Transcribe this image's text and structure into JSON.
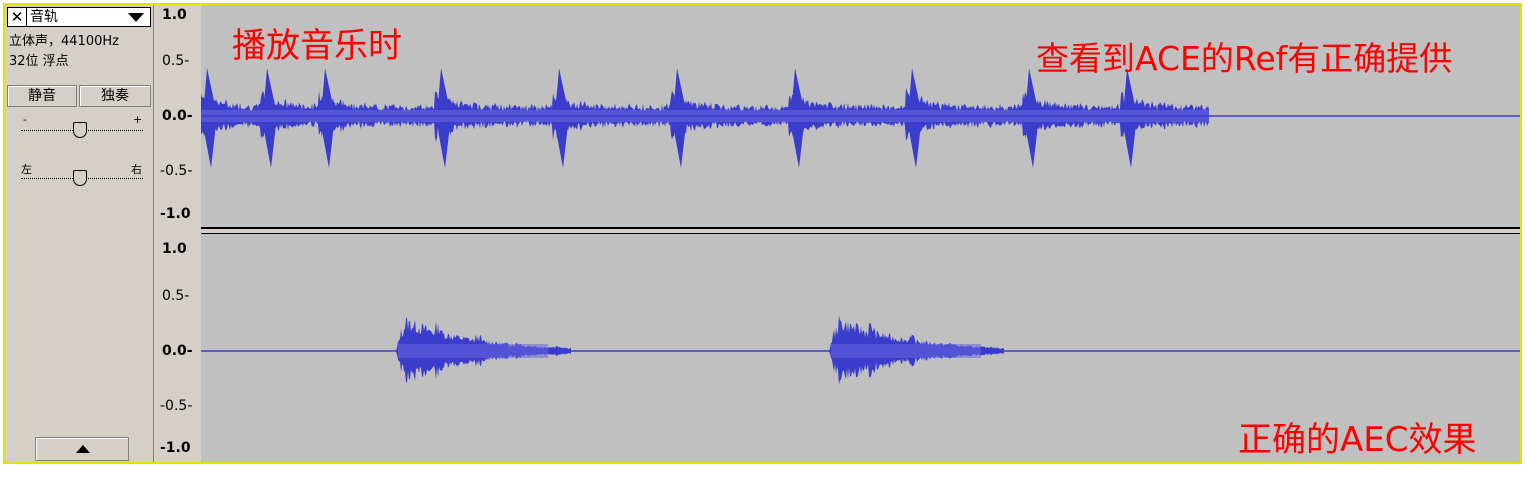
{
  "track": {
    "close_glyph": "✕",
    "name": "音轨",
    "channels_rate": "立体声，44100Hz",
    "format": "32位 浮点",
    "mute_label": "静音",
    "solo_label": "独奏",
    "gain_minus": "-",
    "gain_plus": "+",
    "pan_left": "左",
    "pan_right": "右"
  },
  "scale": {
    "top": [
      "1.0",
      "0.5-",
      "0.0-",
      "-0.5-",
      "-1.0"
    ],
    "bottom": [
      "1.0",
      "0.5-",
      "0.0-",
      "-0.5-",
      "-1.0"
    ]
  },
  "annotations": {
    "play_music": "播放音乐时",
    "ref_note": "查看到ACE的Ref有正确提供",
    "aec_effect": "正确的AEC效果"
  },
  "colors": {
    "waveform": "#3a3ccc",
    "waveform_light": "#6666dd",
    "background": "#c0c0c0",
    "annotation": "#ff0000"
  },
  "waveform_top": {
    "segments": 10,
    "beat_period_s": 0.5,
    "active_until_fraction": 0.76
  },
  "waveform_bottom": {
    "bursts": 2
  }
}
